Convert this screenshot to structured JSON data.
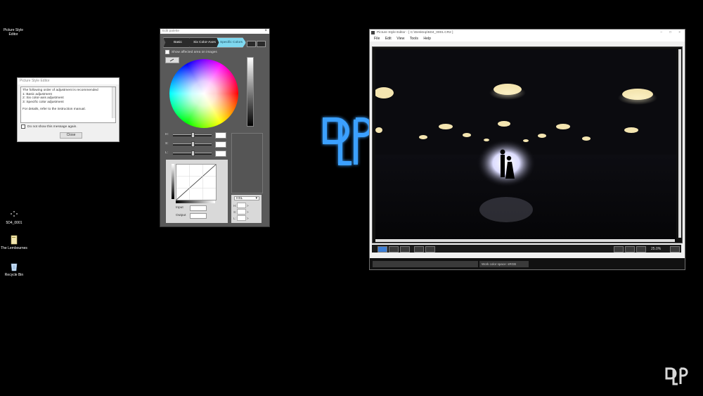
{
  "desktop": {
    "top_icon_label": "Picture Style Editor",
    "icons": [
      {
        "label": "5D4_0001",
        "icon": "image-file-icon"
      },
      {
        "label": "The Lembournes",
        "icon": "folder-icon"
      },
      {
        "label": "Recycle Bin",
        "icon": "recycle-bin-icon"
      }
    ]
  },
  "message_dialog": {
    "title": "Picture Style Editor",
    "lines": [
      "The following order of adjustment is recommended",
      "1: Basic adjustment",
      "2: Six color-axis adjustment",
      "3: Specific color adjustment",
      "",
      "For details, refer to the instruction manual."
    ],
    "checkbox_label": "Do not show this message again.",
    "close_label": "Close"
  },
  "palette": {
    "title": "Edit palette",
    "segments": [
      "Basic",
      "Six Color-Axes",
      "Specific Colors"
    ],
    "active_segment": 2,
    "show_area_label": "Show affected area on images",
    "slider_labels": [
      "H:",
      "S:",
      "L:"
    ],
    "input_label": "Input",
    "output_label": "Output",
    "mode_select": "HSL",
    "readout_labels": [
      "H:",
      "S:",
      "L:"
    ],
    "readout_arrows": [
      ">",
      ">",
      ">"
    ]
  },
  "main_window": {
    "title": "Picture Style Editor - [ C:\\Desktop\\5D4_0001.CR2 ]",
    "menu": [
      "File",
      "Edit",
      "View",
      "Tools",
      "Help"
    ],
    "zoom": "25.0%",
    "status_color_space": "Work color space: sRGB"
  },
  "watermark": {
    "text": "DLP"
  },
  "colors": {
    "accent": "#7fd8ef",
    "watermark_blue": "#2f8fff"
  }
}
